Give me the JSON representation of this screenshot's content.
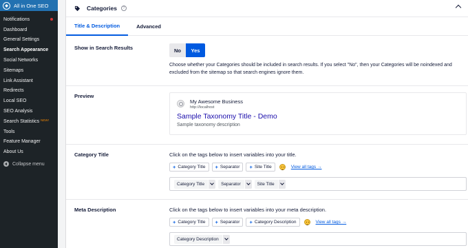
{
  "sidebar": {
    "brand": "All in One SEO",
    "items": [
      {
        "label": "Notifications"
      },
      {
        "label": "Dashboard"
      },
      {
        "label": "General Settings"
      },
      {
        "label": "Search Appearance"
      },
      {
        "label": "Social Networks"
      },
      {
        "label": "Sitemaps"
      },
      {
        "label": "Link Assistant"
      },
      {
        "label": "Redirects"
      },
      {
        "label": "Local SEO"
      },
      {
        "label": "SEO Analysis"
      },
      {
        "label": "Search Statistics",
        "badge": "NEW!"
      },
      {
        "label": "Tools"
      },
      {
        "label": "Feature Manager"
      },
      {
        "label": "About Us"
      }
    ],
    "collapse_label": "Collapse menu"
  },
  "panel": {
    "title": "Categories",
    "help_icon": "?",
    "tabs": [
      "Title & Description",
      "Advanced"
    ]
  },
  "search_results": {
    "label": "Show in Search Results",
    "no": "No",
    "yes": "Yes",
    "description": "Choose whether your Categories should be included in search results. If you select \"No\", then your Categories will be noindexed and excluded from the sitemap so that search engines ignore them."
  },
  "preview": {
    "label": "Preview",
    "site_name": "My Awesome Business",
    "url": "http://localhost",
    "title": "Sample Taxonomy Title - Demo",
    "description": "Sample taxonomy description"
  },
  "category_title": {
    "label": "Category Title",
    "hint": "Click on the tags below to insert variables into your title.",
    "tags": [
      "Category Title",
      "Separator",
      "Site Title"
    ],
    "view_all": "View all tags →",
    "chips": [
      "Category Title",
      "Separator",
      "Site Title"
    ]
  },
  "meta_description": {
    "label": "Meta Description",
    "hint": "Click on the tags below to insert variables into your meta description.",
    "tags": [
      "Category Title",
      "Separator",
      "Category Description"
    ],
    "view_all": "View all tags →",
    "chips": [
      "Category Description"
    ]
  },
  "colors": {
    "accent": "#005ae0",
    "sidebar_bg": "#1d2327",
    "brand_bg": "#2271b1",
    "preview_title": "#1a0dab"
  }
}
